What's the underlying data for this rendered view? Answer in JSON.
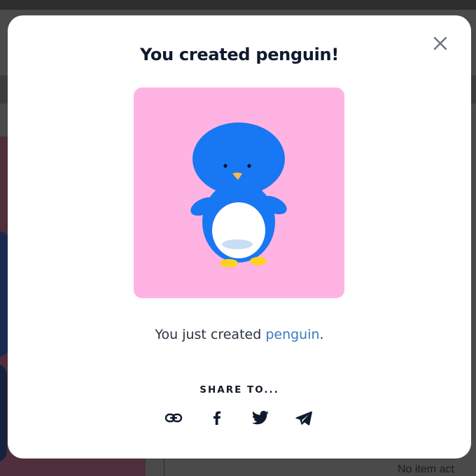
{
  "modal": {
    "title": "You created penguin!",
    "close_icon": "close-icon",
    "image": {
      "subject": "penguin",
      "background_color": "#ffb3e2",
      "body_color": "#1877f2",
      "belly_color": "#ffffff",
      "beak_color": "#ffb84d",
      "feet_color": "#ffd21f"
    },
    "caption": {
      "prefix": "You just created ",
      "link_text": "penguin",
      "suffix": "."
    },
    "share": {
      "label": "SHARE TO...",
      "buttons": [
        {
          "icon": "link-icon",
          "name": "copy-link-button"
        },
        {
          "icon": "facebook-icon",
          "name": "share-facebook-button"
        },
        {
          "icon": "twitter-icon",
          "name": "share-twitter-button"
        },
        {
          "icon": "telegram-icon",
          "name": "share-telegram-button"
        }
      ]
    }
  },
  "background": {
    "status_text": "No item act"
  }
}
